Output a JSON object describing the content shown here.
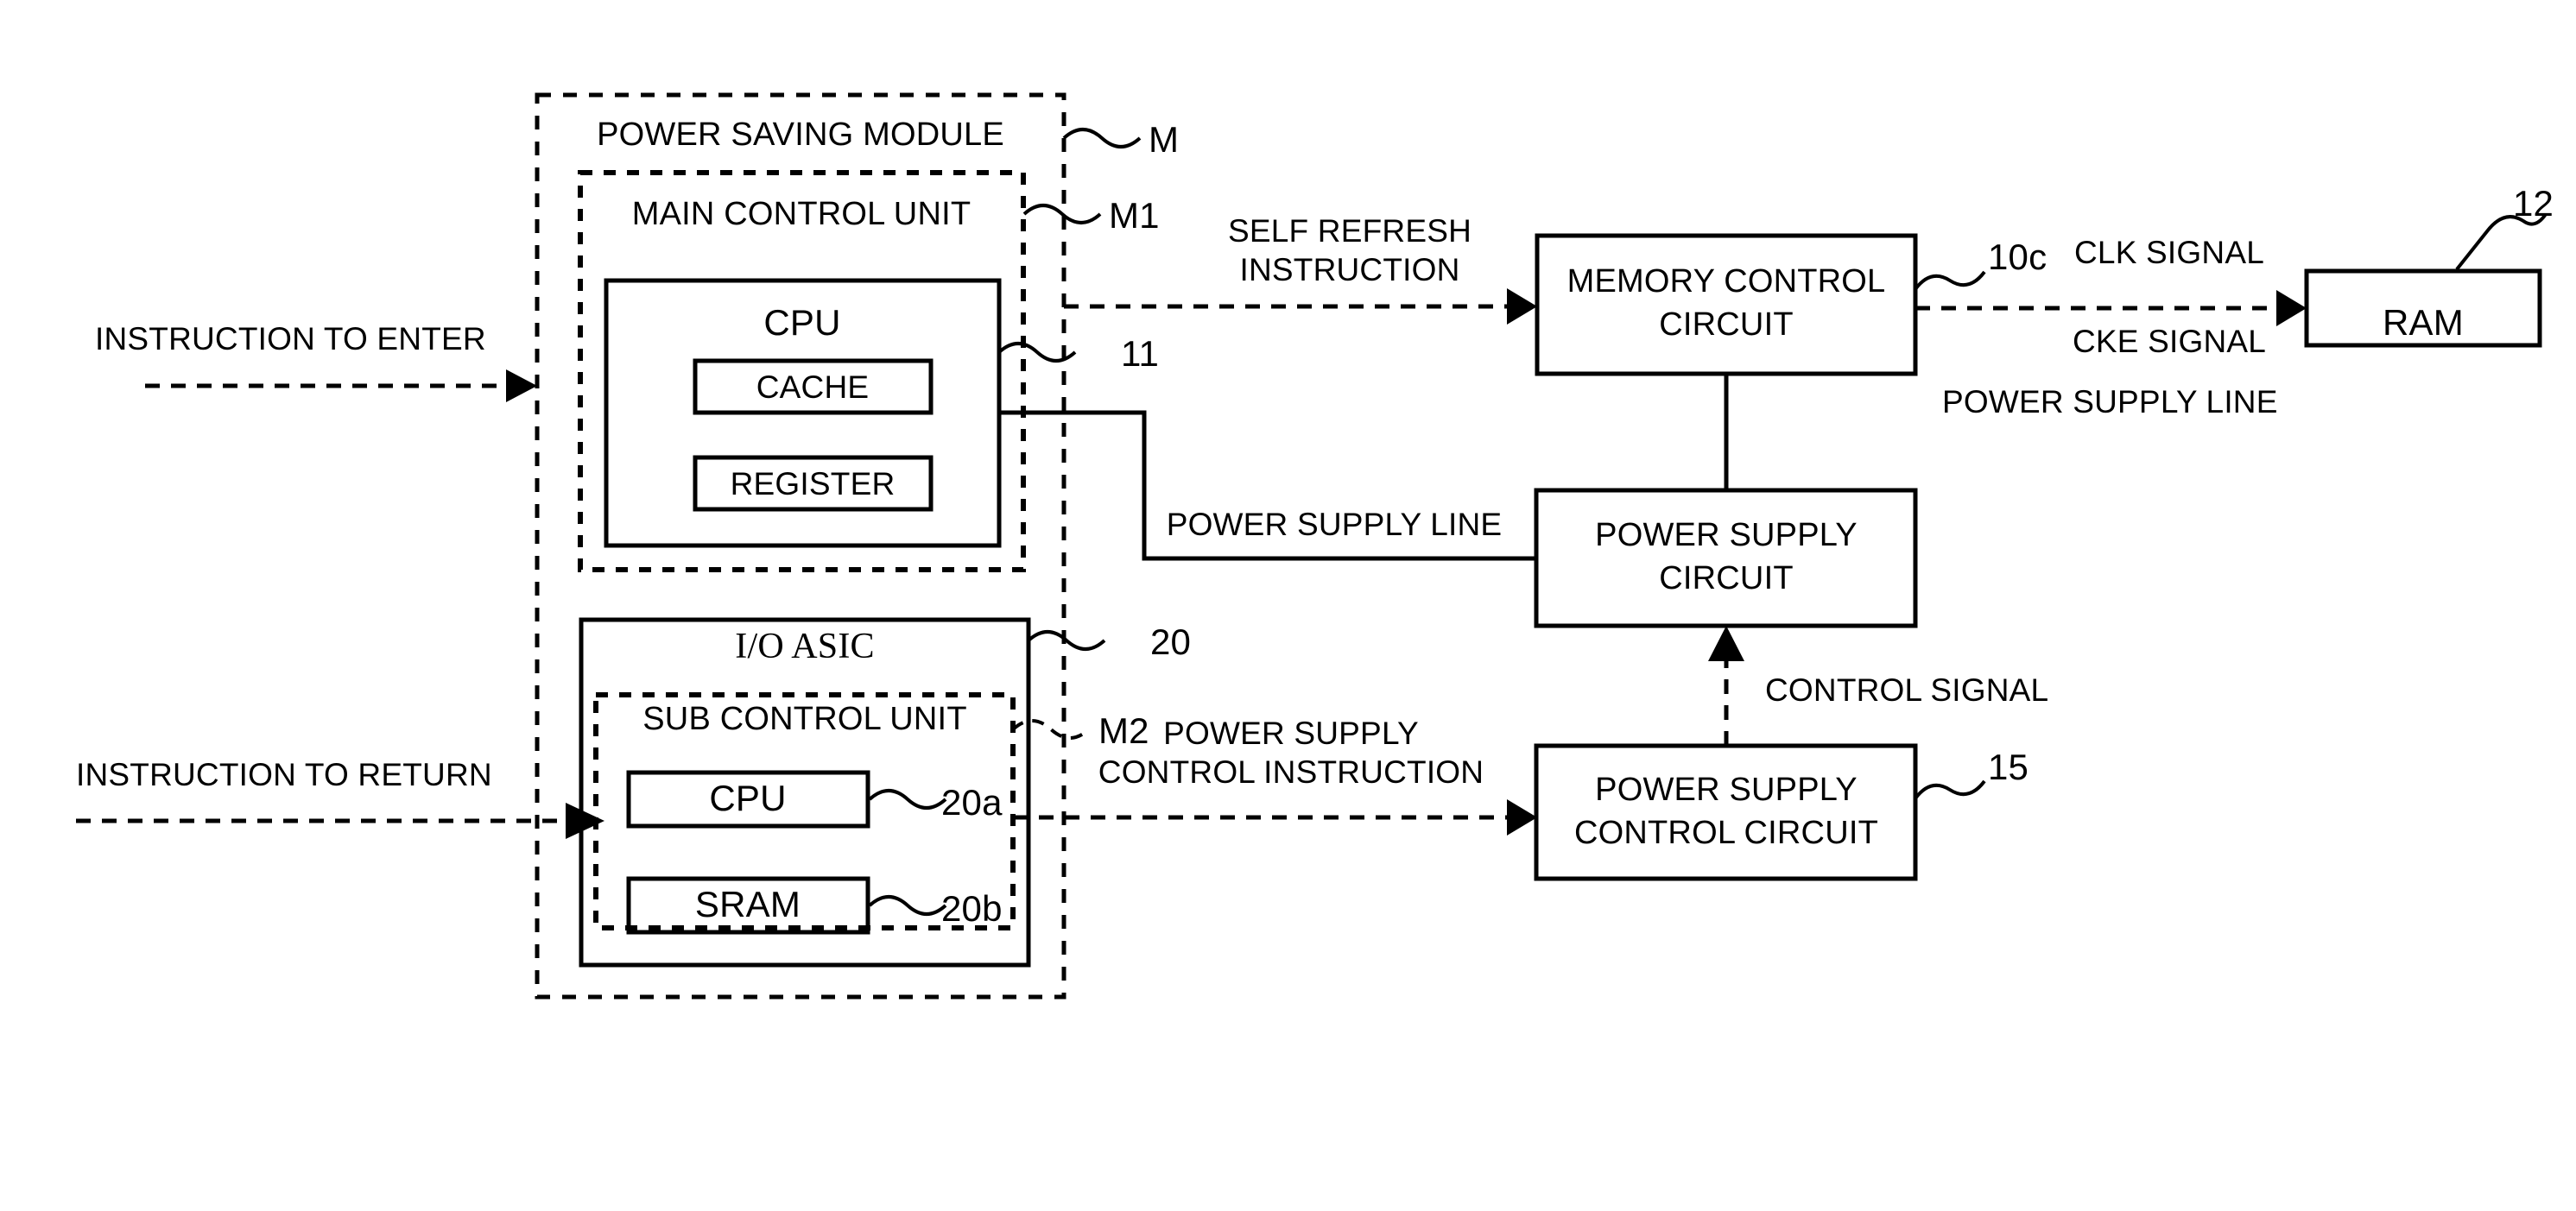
{
  "figure": {
    "type": "patent-block-diagram",
    "background": "#ffffff",
    "line_color": "#000000"
  },
  "containers": {
    "power_saving_module": {
      "label": "POWER SAVING MODULE",
      "ref": "M",
      "border": "dashed"
    },
    "main_control_unit": {
      "label": "MAIN CONTROL UNIT",
      "ref": "M1",
      "border": "dashed"
    },
    "io_asic": {
      "label": "I/O ASIC",
      "ref": "20",
      "border": "solid"
    },
    "sub_control_unit": {
      "label": "SUB CONTROL UNIT",
      "ref": "M2",
      "border": "dashed"
    }
  },
  "blocks": {
    "main_cpu": {
      "label": "CPU",
      "ref": "11",
      "children": [
        {
          "label": "CACHE"
        },
        {
          "label": "REGISTER"
        }
      ]
    },
    "sub_cpu": {
      "label": "CPU",
      "ref": "20a"
    },
    "sram": {
      "label": "SRAM",
      "ref": "20b"
    },
    "memory_control_circuit": {
      "line1": "MEMORY CONTROL",
      "line2": "CIRCUIT",
      "ref": "10c"
    },
    "power_supply_circuit": {
      "line1": "POWER SUPPLY",
      "line2": "CIRCUIT",
      "ref": ""
    },
    "power_supply_control_circuit": {
      "line1": "POWER SUPPLY",
      "line2": "CONTROL CIRCUIT",
      "ref": "15"
    },
    "ram": {
      "label": "RAM",
      "ref": "12"
    }
  },
  "signals": {
    "instruction_to_enter": "INSTRUCTION TO ENTER",
    "instruction_to_return": "INSTRUCTION TO RETURN",
    "self_refresh_line1": "SELF REFRESH",
    "self_refresh_line2": "INSTRUCTION",
    "power_supply_control_line1": "POWER SUPPLY",
    "power_supply_control_line2": "CONTROL INSTRUCTION",
    "power_supply_line_left": "POWER SUPPLY LINE",
    "power_supply_line_right": "POWER SUPPLY LINE",
    "control_signal": "CONTROL SIGNAL",
    "clk_signal": "CLK SIGNAL",
    "cke_signal": "CKE SIGNAL"
  }
}
